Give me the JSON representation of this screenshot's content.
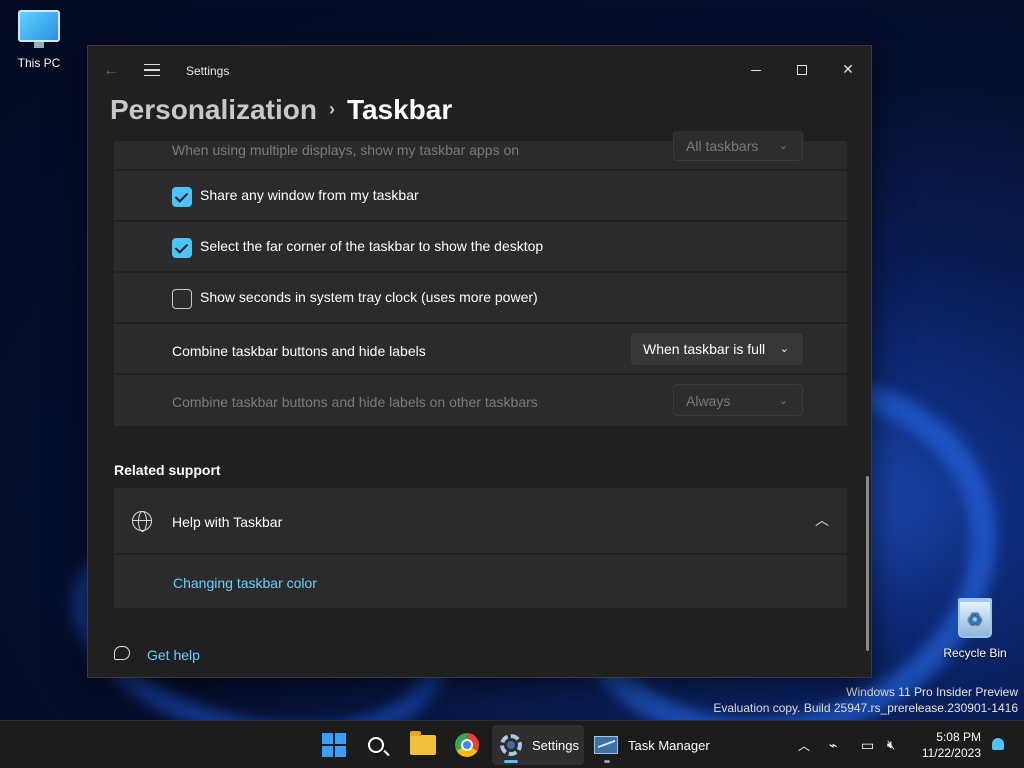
{
  "desktop": {
    "this_pc_label": "This PC",
    "recycle_bin_label": "Recycle Bin",
    "watermark_line1": "Windows 11 Pro Insider Preview",
    "watermark_line2": "Evaluation copy. Build 25947.rs_prerelease.230901-1416"
  },
  "window": {
    "app_title": "Settings",
    "breadcrumb": {
      "parent": "Personalization",
      "separator": "›",
      "current": "Taskbar"
    },
    "controls": {
      "minimize": "—",
      "maximize": "☐",
      "close": "✕"
    }
  },
  "settings": {
    "multi_display": {
      "label": "When using multiple displays, show my taskbar apps on",
      "value": "All taskbars",
      "enabled": false
    },
    "share_window": {
      "label": "Share any window from my taskbar",
      "checked": true
    },
    "far_corner": {
      "label": "Select the far corner of the taskbar to show the desktop",
      "checked": true
    },
    "show_seconds": {
      "label": "Show seconds in system tray clock (uses more power)",
      "checked": false
    },
    "combine_buttons": {
      "label": "Combine taskbar buttons and hide labels",
      "value": "When taskbar is full",
      "enabled": true
    },
    "combine_other": {
      "label": "Combine taskbar buttons and hide labels on other taskbars",
      "value": "Always",
      "enabled": false
    }
  },
  "related_support": {
    "title": "Related support",
    "help_item": {
      "label": "Help with Taskbar",
      "expanded": true,
      "icon": "globe-icon"
    },
    "links": [
      "Changing taskbar color"
    ]
  },
  "footer": {
    "get_help": "Get help"
  },
  "taskbar": {
    "apps": [
      {
        "name": "Start",
        "icon": "windows-logo-icon"
      },
      {
        "name": "Search",
        "icon": "search-icon"
      },
      {
        "name": "File Explorer",
        "icon": "folder-icon"
      },
      {
        "name": "Chrome",
        "icon": "chrome-icon"
      },
      {
        "name": "Settings",
        "label": "Settings",
        "icon": "gear-icon",
        "active": true
      },
      {
        "name": "Task Manager",
        "label": "Task Manager",
        "icon": "task-manager-icon"
      }
    ],
    "time": "5:08 PM",
    "date": "11/22/2023",
    "accent": "#4cc2ff"
  }
}
